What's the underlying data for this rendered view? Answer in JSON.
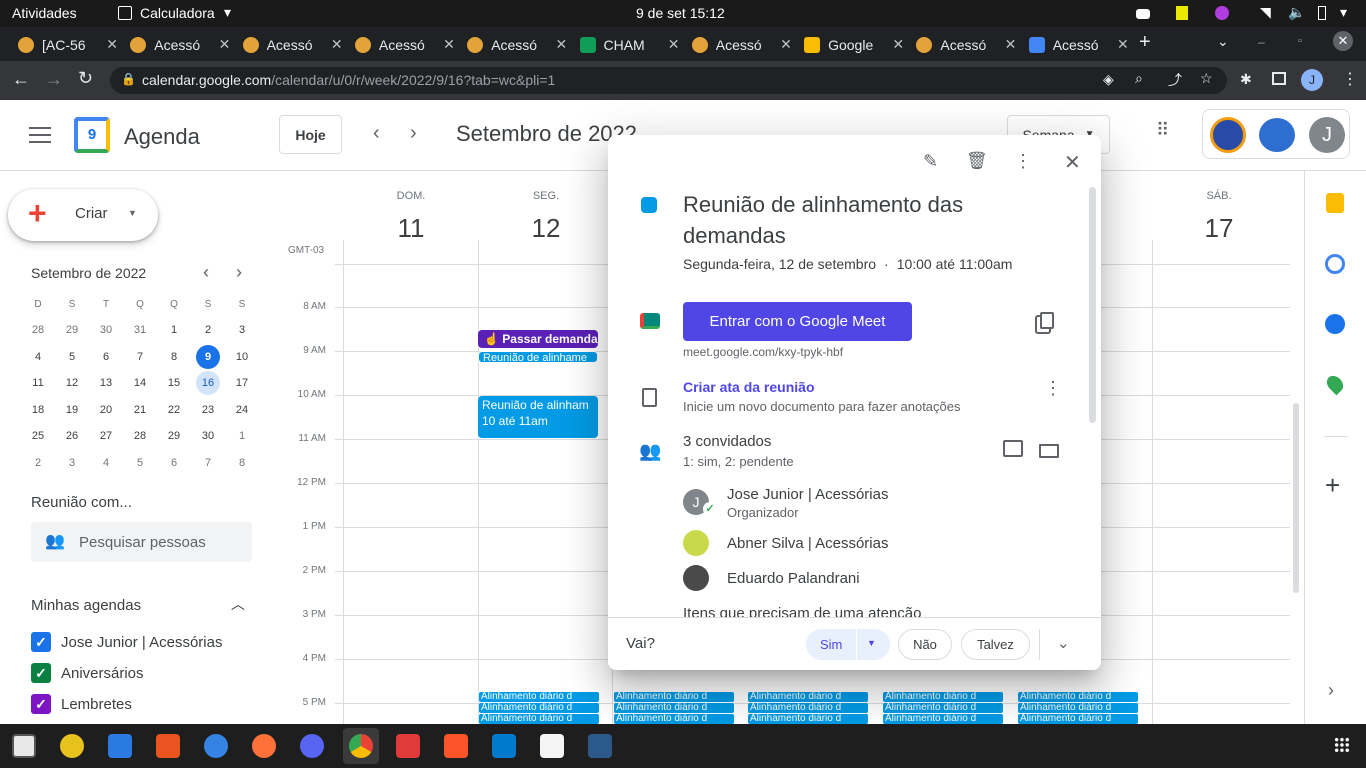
{
  "system": {
    "activities": "Atividades",
    "app_name": "Calculadora",
    "clock": "9 de set  15:12"
  },
  "tabs": [
    {
      "label": "[AC-56",
      "fav": "#e2a33a"
    },
    {
      "label": "Acessó",
      "fav": "#e2a33a"
    },
    {
      "label": "Acessó",
      "fav": "#e2a33a"
    },
    {
      "label": "Acessó",
      "fav": "#e2a33a"
    },
    {
      "label": "Acessó",
      "fav": "#e2a33a"
    },
    {
      "label": "CHAM",
      "fav": "#0f9d58"
    },
    {
      "label": "Acessó",
      "fav": "#e2a33a"
    },
    {
      "label": "Google",
      "fav": "#fbbc04"
    },
    {
      "label": "Acessó",
      "fav": "#e2a33a"
    },
    {
      "label": "Acessó",
      "fav": "#4285f4"
    }
  ],
  "address": {
    "host": "calendar.google.com",
    "path": "/calendar/u/0/r/week/2022/9/16?tab=wc&pli=1"
  },
  "header": {
    "app_title": "Agenda",
    "logo_day": "9",
    "today_button": "Hoje",
    "month_title": "Setembro de 2022",
    "view_select": "Semana",
    "avatar_letter": "J"
  },
  "sidebar": {
    "create_label": "Criar",
    "mini_title": "Setembro de 2022",
    "weekdays": [
      "D",
      "S",
      "T",
      "Q",
      "Q",
      "S",
      "S"
    ],
    "weeks": [
      [
        "28",
        "29",
        "30",
        "31",
        "1",
        "2",
        "3"
      ],
      [
        "4",
        "5",
        "6",
        "7",
        "8",
        "9",
        "10"
      ],
      [
        "11",
        "12",
        "13",
        "14",
        "15",
        "16",
        "17"
      ],
      [
        "18",
        "19",
        "20",
        "21",
        "22",
        "23",
        "24"
      ],
      [
        "25",
        "26",
        "27",
        "28",
        "29",
        "30",
        "1"
      ],
      [
        "2",
        "3",
        "4",
        "5",
        "6",
        "7",
        "8"
      ]
    ],
    "meet_title": "Reunião com...",
    "search_placeholder": "Pesquisar pessoas",
    "my_calendars_title": "Minhas agendas",
    "calendars": [
      {
        "label": "Jose Junior | Acessórias",
        "color": "#1a73e8"
      },
      {
        "label": "Aniversários",
        "color": "#0b8043"
      },
      {
        "label": "Lembretes",
        "color": "#7e15c5"
      }
    ]
  },
  "grid": {
    "timezone": "GMT-03",
    "days": [
      {
        "name": "DOM.",
        "num": "11"
      },
      {
        "name": "SEG.",
        "num": "12"
      },
      {
        "name": "SÁB.",
        "num": "17"
      }
    ],
    "hours": [
      "8 AM",
      "9 AM",
      "10 AM",
      "11 AM",
      "12 PM",
      "1 PM",
      "2 PM",
      "3 PM",
      "4 PM",
      "5 PM"
    ],
    "events": {
      "passar": "Passar demanda",
      "reuniao_small": "Reunião de alinhame",
      "reuniao_title": "Reunião de alinham",
      "reuniao_time": "10 até 11am",
      "daily": "Alinhamento diário d"
    }
  },
  "popup": {
    "title": "Reunião de alinhamento das demandas",
    "date": "Segunda-feira, 12 de setembro",
    "time": "10:00 até 11:00am",
    "meet_button": "Entrar com o Google Meet",
    "meet_link": "meet.google.com/kxy-tpyk-hbf",
    "notes_title": "Criar ata da reunião",
    "notes_sub": "Inicie um novo documento para fazer anotações",
    "guests_title": "3 convidados",
    "guests_sub": "1: sim, 2: pendente",
    "guests": [
      {
        "name": "Jose Junior | Acessórias",
        "role": "Organizador",
        "initial": "J"
      },
      {
        "name": "Abner Silva | Acessórias",
        "role": ""
      },
      {
        "name": "Eduardo Palandrani",
        "role": ""
      }
    ],
    "attention": "Itens que precisam de uma atenção",
    "rsvp_label": "Vai?",
    "rsvp_yes": "Sim",
    "rsvp_no": "Não",
    "rsvp_maybe": "Talvez",
    "event_color": "#039be5",
    "accent": "#4f46e5"
  }
}
